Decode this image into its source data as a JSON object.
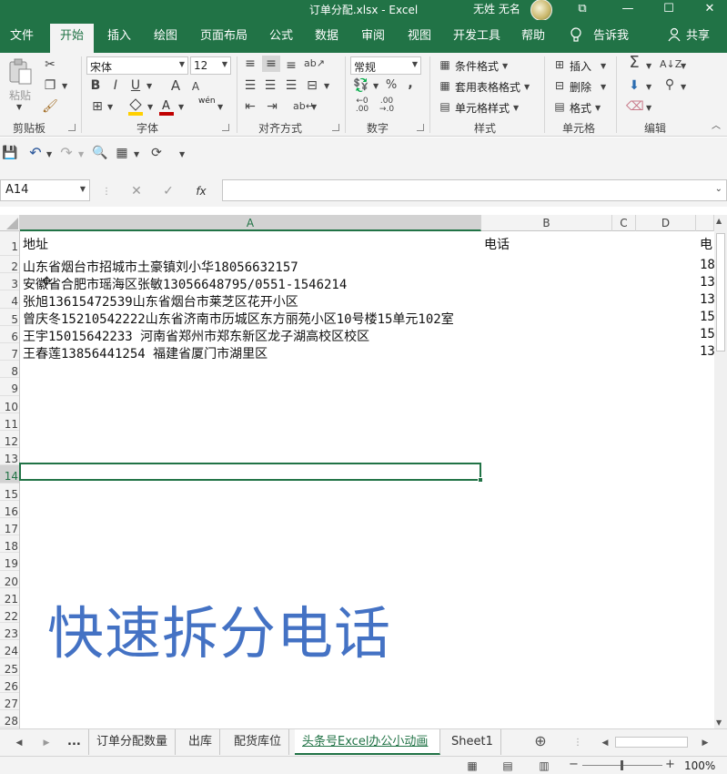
{
  "window": {
    "title": "订单分配.xlsx  -  Excel",
    "user": "无姓 无名",
    "restore_glyph": "⧉",
    "minimize_glyph": "—",
    "maximize_glyph": "☐",
    "close_glyph": "✕"
  },
  "ribbon_tabs": [
    "文件",
    "开始",
    "插入",
    "绘图",
    "页面布局",
    "公式",
    "数据",
    "审阅",
    "视图",
    "开发工具",
    "帮助"
  ],
  "tell_me": "告诉我",
  "share": "共享",
  "clipboard": {
    "paste": "粘贴",
    "group": "剪贴板"
  },
  "font": {
    "name": "宋体",
    "size": "12",
    "group": "字体",
    "bold": "B",
    "italic": "I",
    "underline": "U",
    "grow": "A",
    "shrink": "A",
    "phonetic": "wén"
  },
  "alignment": {
    "group": "对齐方式"
  },
  "number": {
    "format": "常规",
    "group": "数字",
    "percent": "%",
    "comma": ","
  },
  "styles": {
    "conditional": "条件格式",
    "table": "套用表格格式",
    "cell": "单元格样式",
    "group": "样式"
  },
  "cells_group": {
    "insert": "插入",
    "delete": "删除",
    "format": "格式",
    "group": "单元格"
  },
  "editing": {
    "group": "编辑",
    "sum": "Σ"
  },
  "formula_bar": {
    "name_box": "A14",
    "fx": "fx",
    "value": ""
  },
  "columns": [
    "A",
    "B",
    "C",
    "D"
  ],
  "rows": [
    "1",
    "2",
    "3",
    "4",
    "5",
    "6",
    "7",
    "8",
    "9",
    "10",
    "11",
    "12",
    "13",
    "14",
    "15",
    "16",
    "17",
    "18",
    "19",
    "20",
    "21",
    "22",
    "23",
    "24",
    "25",
    "26",
    "27",
    "28"
  ],
  "cells": {
    "A1": "地址",
    "B1": "电话",
    "E1": "电",
    "A2": "山东省烟台市招城市土豪镇刘小华18056632157",
    "E2": "18",
    "A3": "安徽省合肥市瑶海区张敏13056648795/0551-1546214",
    "E3": "13",
    "A4": "张旭13615472539山东省烟台市莱芝区花开小区",
    "E4": "13",
    "A5": "曾庆冬15210542222山东省济南市历城区东方丽苑小区10号楼15单元102室",
    "E5": "15",
    "A6": "王宇15015642233 河南省郑州市郑东新区龙子湖高校区校区",
    "E6": "15",
    "A7": "王春莲13856441254 福建省厦门市湖里区",
    "E7": "13"
  },
  "overlay_caption": "快速拆分电话",
  "sheet_tabs": [
    "...",
    "订单分配数量",
    "出库",
    "配货库位",
    "头条号Excel办公小动画",
    "Sheet1"
  ],
  "active_sheet_index": 4,
  "status": {
    "zoom": "100%",
    "minus": "−",
    "plus": "+"
  },
  "colors": {
    "excel_green": "#217346",
    "caption_blue": "#4472c4"
  }
}
